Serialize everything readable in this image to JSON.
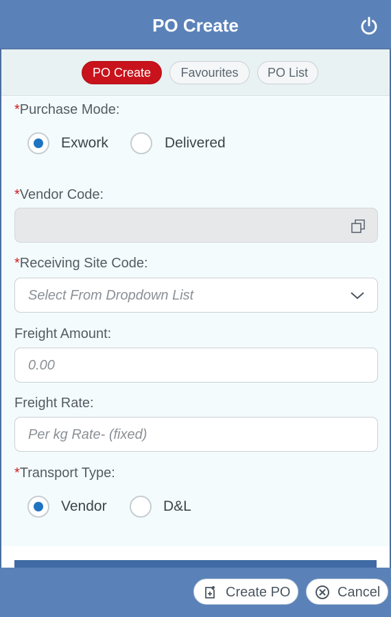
{
  "header": {
    "title": "PO Create",
    "power_icon": "power-icon"
  },
  "tabs": [
    {
      "label": "PO Create",
      "active": true
    },
    {
      "label": "Favourites",
      "active": false
    },
    {
      "label": "PO List",
      "active": false
    }
  ],
  "form": {
    "purchase_mode": {
      "required_mark": "*",
      "label": "Purchase Mode:",
      "options": [
        {
          "label": "Exwork",
          "checked": true
        },
        {
          "label": "Delivered",
          "checked": false
        }
      ]
    },
    "vendor_code": {
      "required_mark": "*",
      "label": "Vendor Code:",
      "value": "",
      "icon": "copy-icon"
    },
    "receiving_site_code": {
      "required_mark": "*",
      "label": "Receiving Site Code:",
      "placeholder": "Select From Dropdown List",
      "icon": "chevron-down-icon"
    },
    "freight_amount": {
      "label": "Freight Amount:",
      "placeholder": "0.00"
    },
    "freight_rate": {
      "label": "Freight Rate:",
      "placeholder": "Per kg Rate- (fixed)"
    },
    "transport_type": {
      "required_mark": "*",
      "label": "Transport Type:",
      "options": [
        {
          "label": "Vendor",
          "checked": true
        },
        {
          "label": "D&L",
          "checked": false
        }
      ]
    }
  },
  "footer": {
    "create_label": "Create PO",
    "cancel_label": "Cancel"
  },
  "colors": {
    "header": "#5b82b8",
    "active_tab": "#c8131c",
    "radio_checked": "#1f74c2",
    "required": "#d01b1b"
  }
}
